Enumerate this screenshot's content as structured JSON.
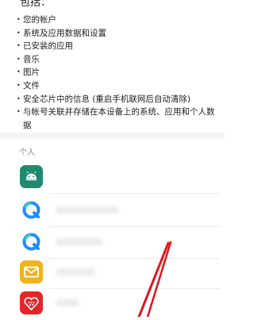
{
  "permissions": {
    "heading": "包括：",
    "items": [
      "您的帐户",
      "系统及应用数据和设置",
      "已安装的应用",
      "音乐",
      "图片",
      "文件",
      "安全芯片中的信息 (重启手机联网后自动清除)",
      "与帐号关联并存储在本设备上的系统、应用和个人数据"
    ]
  },
  "personal": {
    "title": "个人",
    "apps": [
      {
        "icon": "android-icon",
        "color": "#1f8a6e"
      },
      {
        "icon": "browser-icon",
        "color": "#ffffff"
      },
      {
        "icon": "browser-icon",
        "color": "#ffffff"
      },
      {
        "icon": "mail-icon",
        "color": "#f2b21b"
      },
      {
        "icon": "gift-icon",
        "color": "#e3262a"
      }
    ]
  },
  "colors": {
    "annotation": "#e0161b",
    "section_gap": "#f4f4f6"
  }
}
